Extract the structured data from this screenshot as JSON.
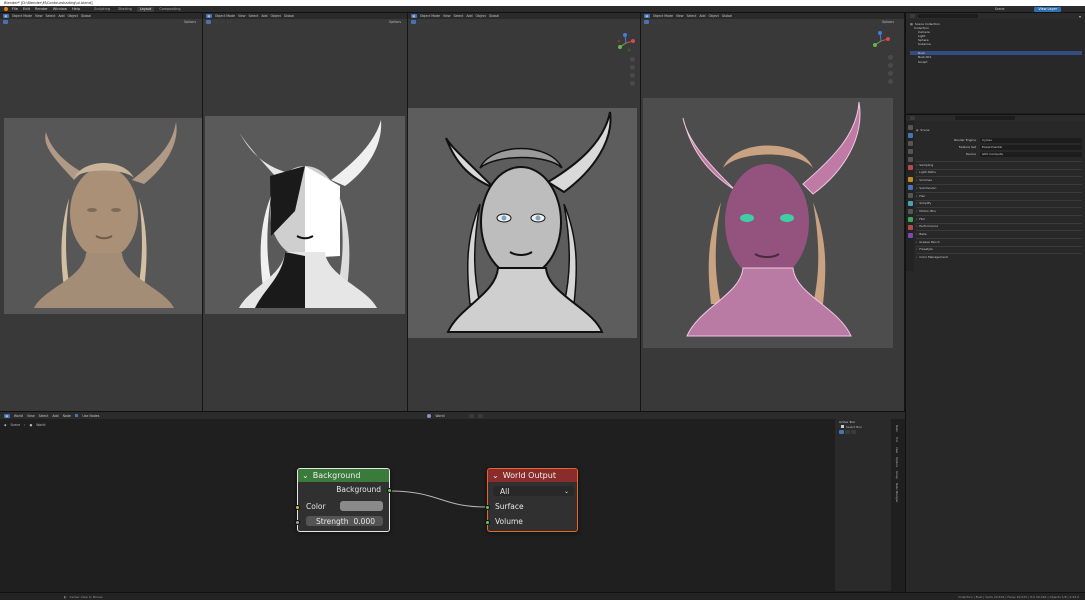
{
  "window": {
    "title": "Blender* [D:\\Blender\\M\\Contourshading\\ui.blend]"
  },
  "menu": {
    "items": [
      "File",
      "Edit",
      "Render",
      "Window",
      "Help"
    ],
    "workspaces": [
      "Sculpting",
      "Shading",
      "Layout",
      "Compositing"
    ],
    "active_workspace": "Layout",
    "scene_label": "Scene",
    "view_layer_label": "View Layer"
  },
  "viewports": [
    {
      "mode": "Object Mode",
      "menus": [
        "View",
        "Select",
        "Add",
        "Object"
      ],
      "transform": "Global",
      "options": "Options",
      "style": "clay"
    },
    {
      "mode": "Object Mode",
      "menus": [
        "View",
        "Select",
        "Add",
        "Object"
      ],
      "transform": "Global",
      "options": "Options",
      "style": "toon"
    },
    {
      "mode": "Object Mode",
      "menus": [
        "View",
        "Select",
        "Add",
        "Object"
      ],
      "transform": "Global",
      "options": "Options",
      "style": "grey"
    },
    {
      "mode": "Object Mode",
      "menus": [
        "View",
        "Select",
        "Add",
        "Object"
      ],
      "transform": "Global",
      "options": "Options",
      "style": "pink"
    }
  ],
  "node_editor": {
    "type": "World",
    "menus": [
      "View",
      "Select",
      "Add",
      "Node"
    ],
    "use_nodes": "Use Nodes",
    "world_field": "World",
    "breadcrumb": [
      "Scene",
      "World"
    ],
    "background_node": {
      "title": "Background",
      "output": "Background",
      "color_label": "Color",
      "strength_label": "Strength",
      "strength_value": "0.000",
      "color_swatch": "#8a8a8a"
    },
    "output_node": {
      "title": "World Output",
      "target": "All",
      "inputs": [
        "Surface",
        "Volume"
      ]
    },
    "side_panel": {
      "title": "Active Tool",
      "tool": "Select Box"
    },
    "side_tabs": [
      "Node",
      "Tool",
      "View",
      "Options",
      "Group",
      "Node Wrangler"
    ]
  },
  "outliner": {
    "title": "Scene Collection",
    "items": [
      {
        "name": "Collection",
        "level": 1,
        "selected": false
      },
      {
        "name": "Camera",
        "level": 2,
        "selected": false
      },
      {
        "name": "Light",
        "level": 2,
        "selected": false
      },
      {
        "name": "Sphere",
        "level": 2,
        "selected": false
      },
      {
        "name": "Suzanne",
        "level": 2,
        "selected": false
      },
      {
        "name": "Bust",
        "level": 2,
        "selected": true
      },
      {
        "name": "Bust.001",
        "level": 2,
        "selected": false
      },
      {
        "name": "Sculpt",
        "level": 2,
        "selected": false
      }
    ]
  },
  "properties": {
    "context": "Scene",
    "render_engine_label": "Render Engine",
    "render_engine": "Cycles",
    "feature_set_label": "Feature Set",
    "feature_set": "Experimental",
    "device_label": "Device",
    "device": "GPU Compute",
    "sections": [
      "Sampling",
      "Light Paths",
      "Volumes",
      "Subdivision",
      "Hair",
      "Simplify",
      "Motion Blur",
      "Film",
      "Performance",
      "Bake",
      "Grease Pencil",
      "Freestyle",
      "Color Management"
    ]
  },
  "status": {
    "left": "Center View to Mouse",
    "right": "Collection | Bust | Verts 29,634 | Faces 29,632 | Tris 59,264 | Objects 1/8 | 2.93.0"
  },
  "colors": {
    "node_green": "#3a7a3a",
    "node_red": "#8a2c2c",
    "socket_yellow": "#c7c729",
    "socket_green": "#63c763",
    "socket_grey": "#a1a1a1",
    "accent_blue": "#4772b3"
  }
}
